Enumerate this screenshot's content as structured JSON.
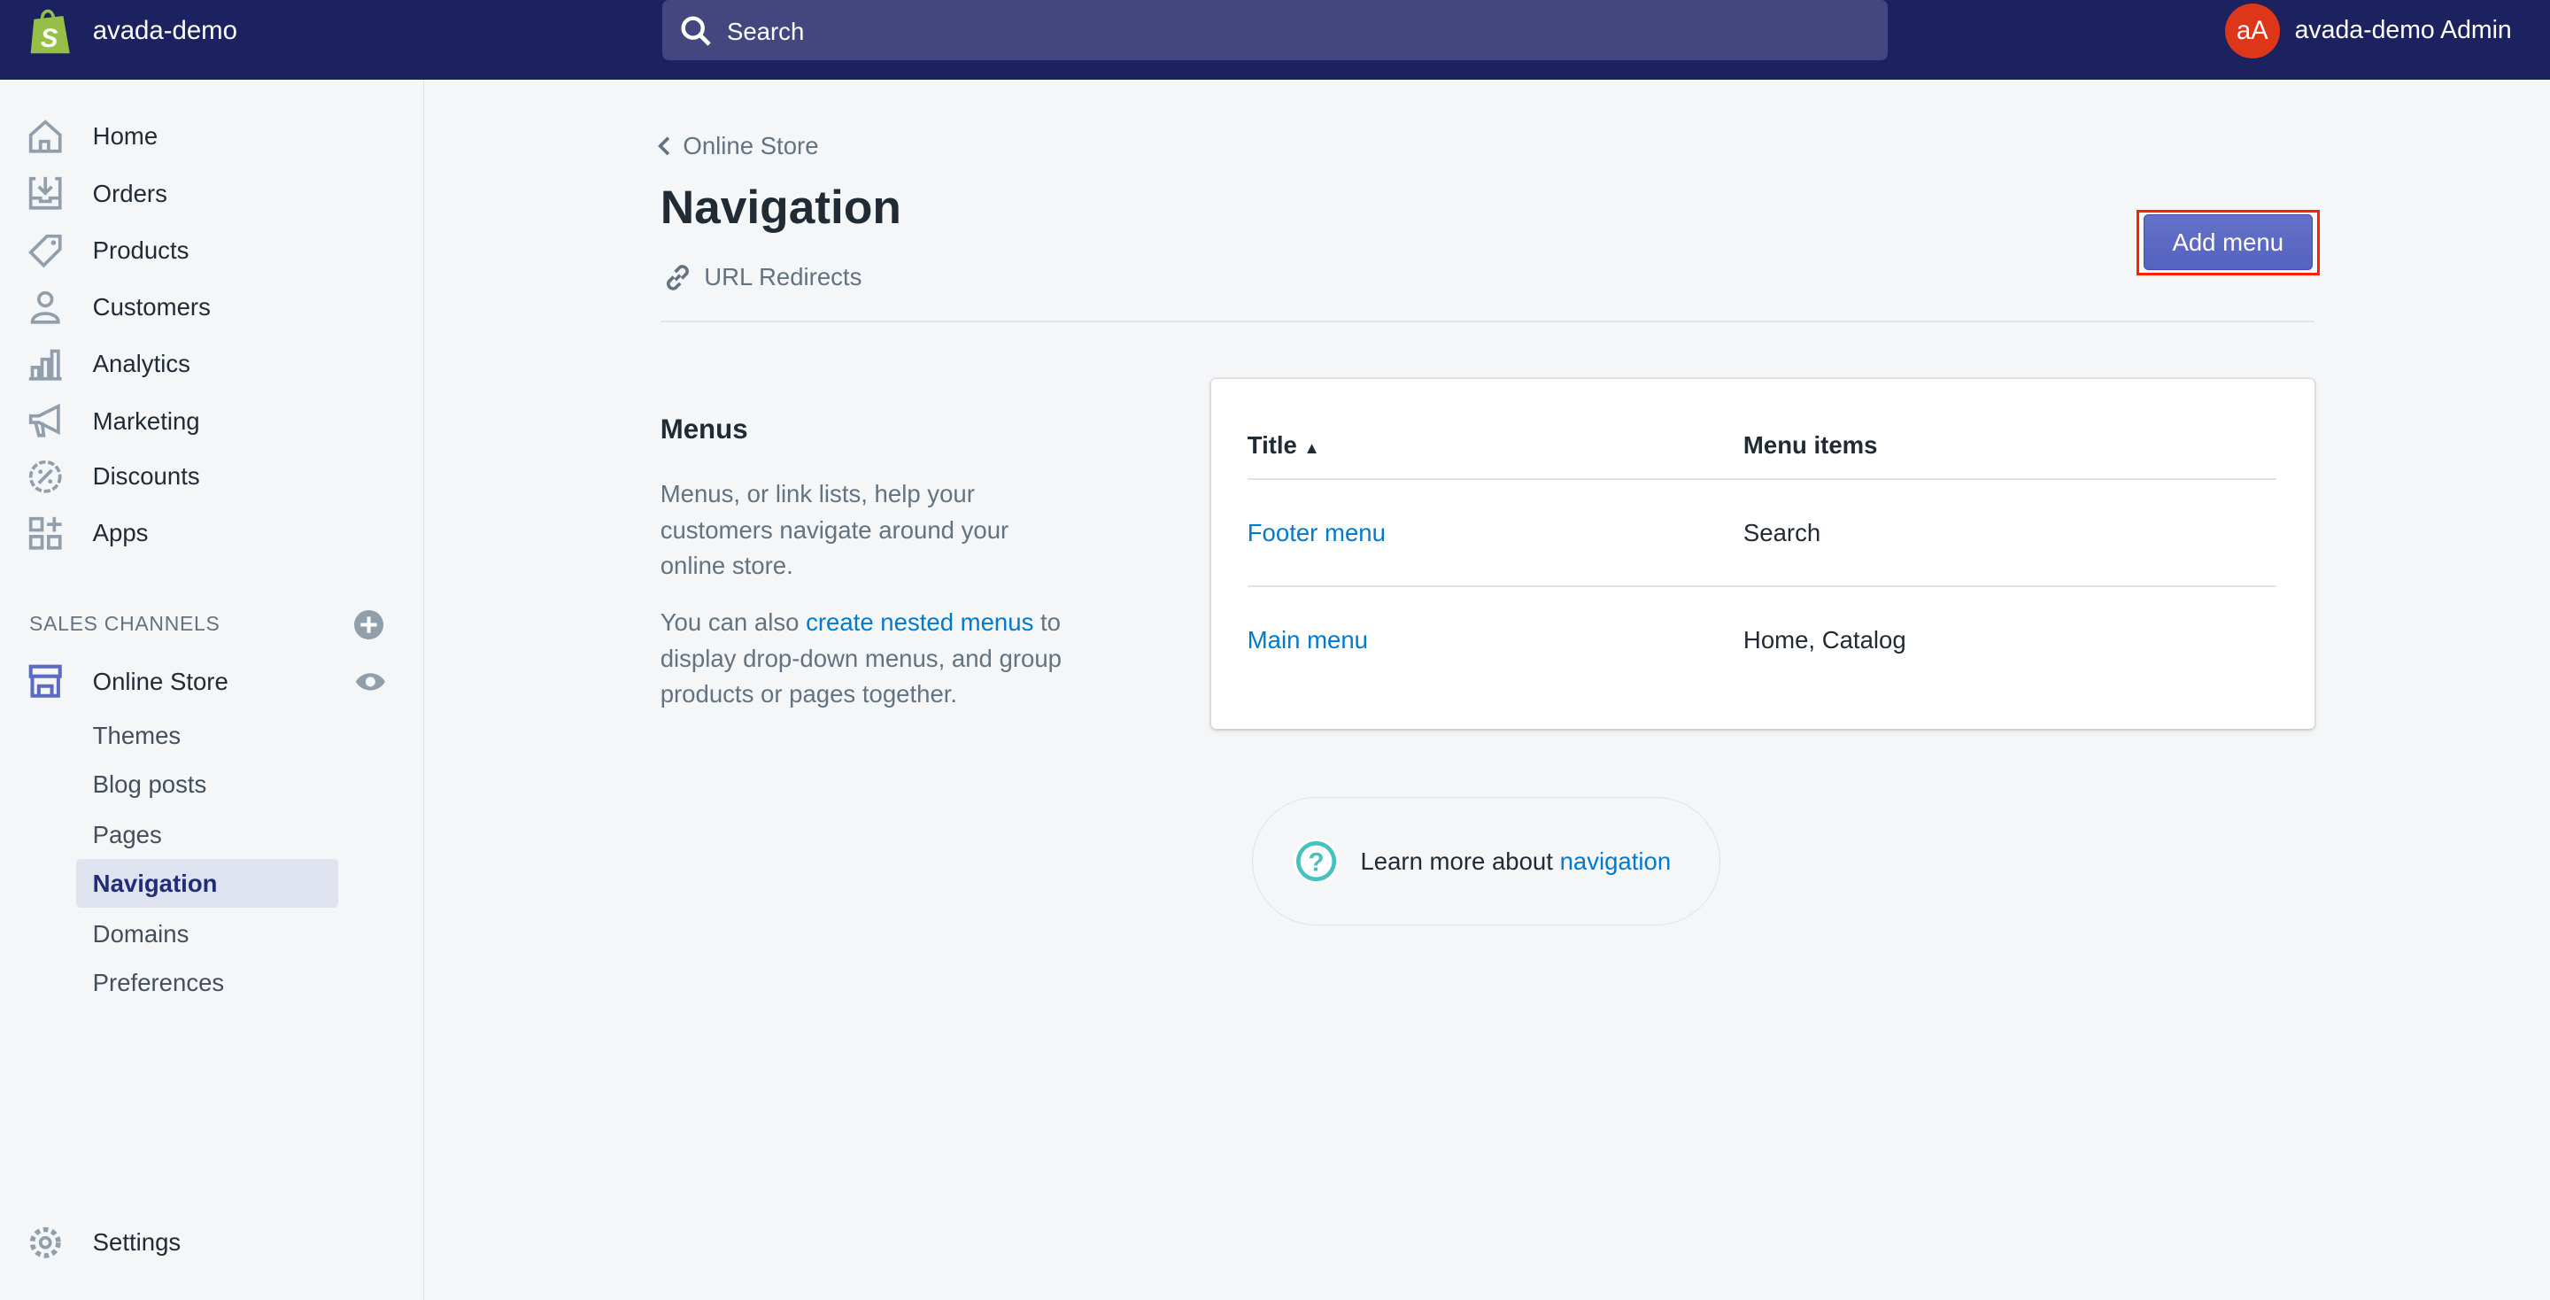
{
  "topbar": {
    "store_name": "avada-demo",
    "search_placeholder": "Search",
    "avatar_initials": "aA",
    "user_name": "avada-demo Admin"
  },
  "sidebar": {
    "items": [
      {
        "label": "Home",
        "icon": "home-icon"
      },
      {
        "label": "Orders",
        "icon": "orders-icon"
      },
      {
        "label": "Products",
        "icon": "tag-icon"
      },
      {
        "label": "Customers",
        "icon": "person-icon"
      },
      {
        "label": "Analytics",
        "icon": "bar-chart-icon"
      },
      {
        "label": "Marketing",
        "icon": "megaphone-icon"
      },
      {
        "label": "Discounts",
        "icon": "discount-icon"
      },
      {
        "label": "Apps",
        "icon": "apps-icon"
      }
    ],
    "sales_channels_label": "SALES CHANNELS",
    "channel": "Online Store",
    "subitems": [
      "Themes",
      "Blog posts",
      "Pages",
      "Navigation",
      "Domains",
      "Preferences"
    ],
    "active_subitem": "Navigation",
    "settings": "Settings"
  },
  "page": {
    "breadcrumb": "Online Store",
    "title": "Navigation",
    "url_redirects": "URL Redirects",
    "add_menu": "Add menu",
    "menus_heading": "Menus",
    "menus_desc": "Menus, or link lists, help your customers navigate around your online store.",
    "nested_pre": "You can also ",
    "nested_link": "create nested menus",
    "nested_post": " to display drop-down menus, and group products or pages together.",
    "table": {
      "col_title": "Title",
      "col_items": "Menu items",
      "rows": [
        {
          "title": "Footer menu",
          "items": "Search"
        },
        {
          "title": "Main menu",
          "items": "Home, Catalog"
        }
      ]
    },
    "learn_pre": "Learn more about ",
    "learn_link": "navigation"
  },
  "colors": {
    "topbar": "#1c2260",
    "primary": "#5c6ac4",
    "link": "#007ace",
    "avatar": "#de3618",
    "highlight": "#ff2000"
  }
}
